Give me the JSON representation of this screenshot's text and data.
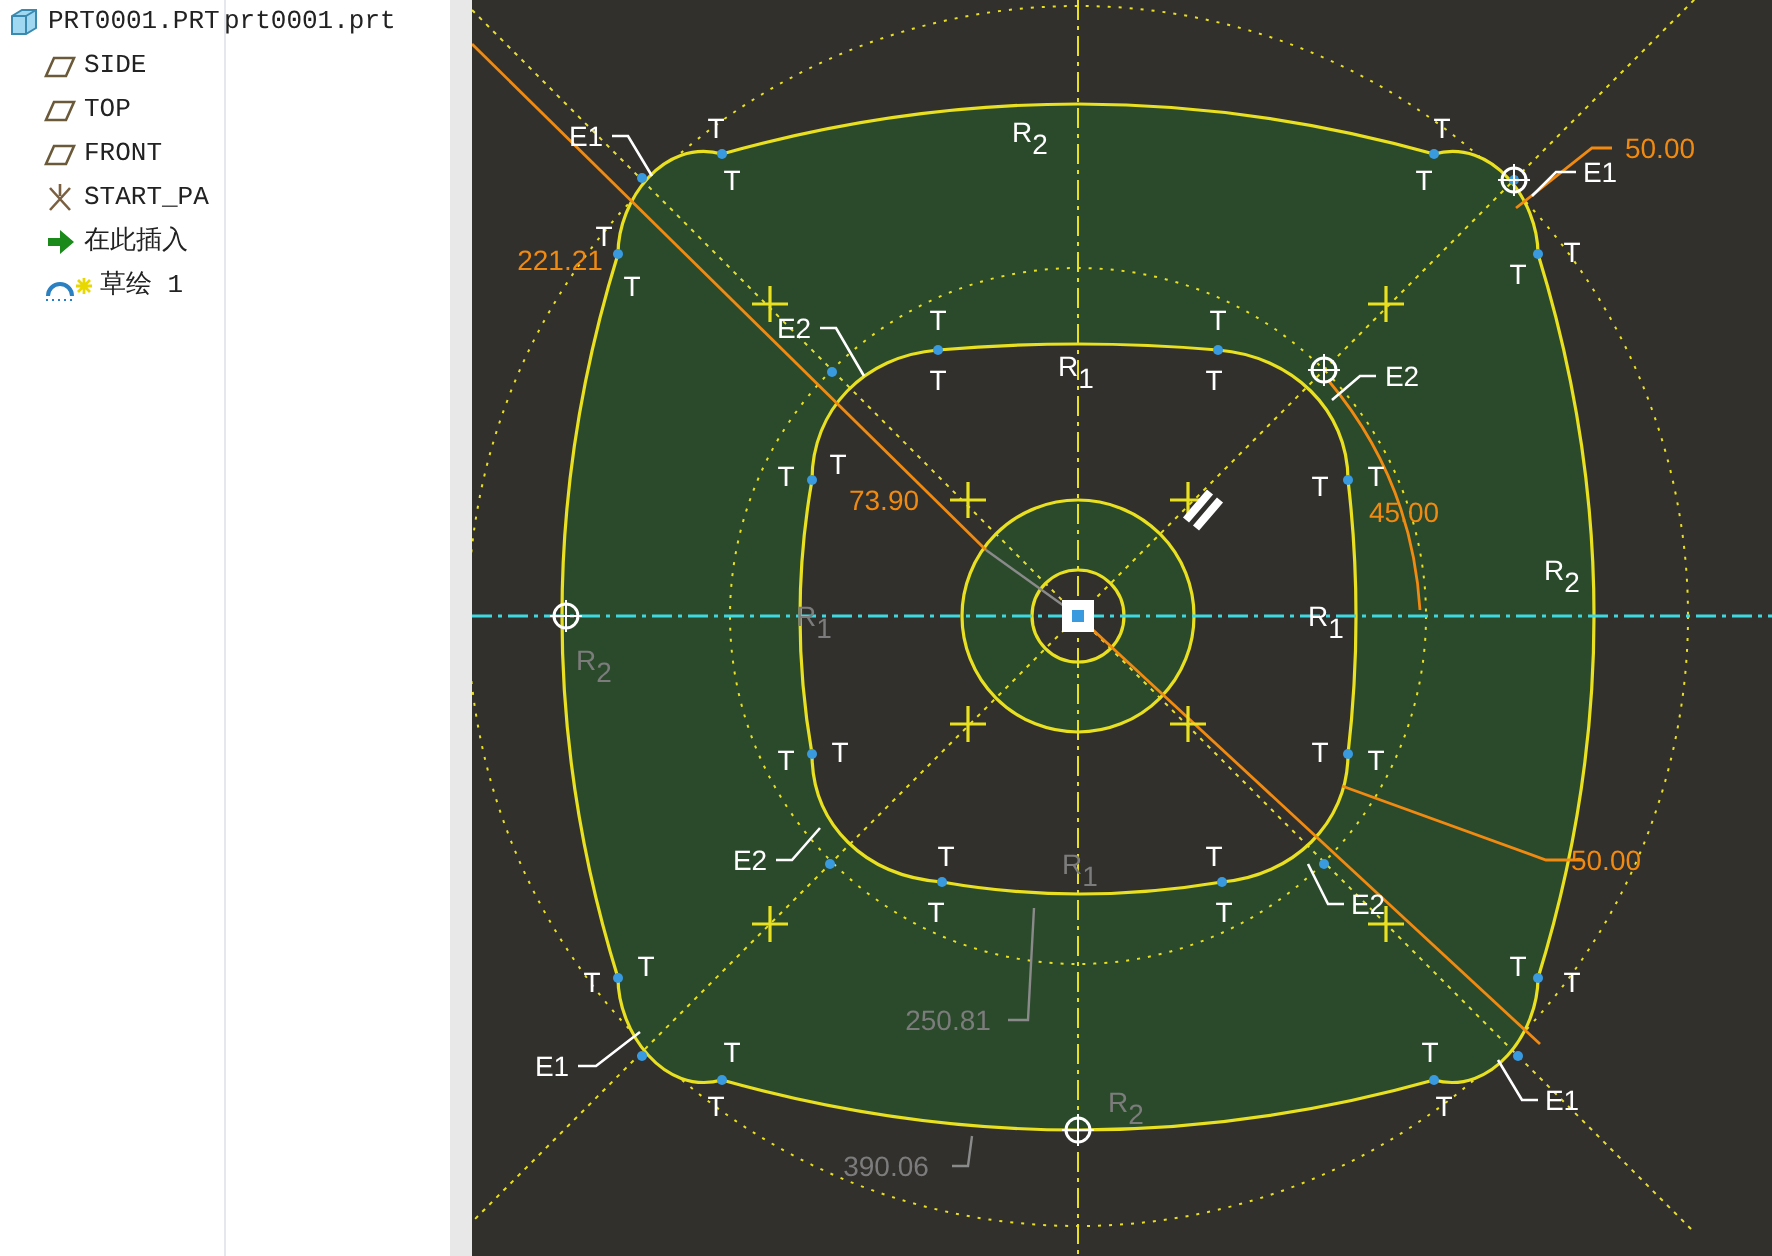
{
  "model_tree": {
    "label": "PRT0001.PRT",
    "column_2": "prt0001.prt",
    "children": [
      {
        "label": "SIDE",
        "kind": "datum_plane",
        "new": false
      },
      {
        "label": "TOP",
        "kind": "datum_plane",
        "new": false
      },
      {
        "label": "FRONT",
        "kind": "datum_plane",
        "new": false
      },
      {
        "label": "START_PA",
        "kind": "csys",
        "new": false
      },
      {
        "label": "在此插入",
        "kind": "insert_here",
        "new": false
      },
      {
        "label": "草绘 1",
        "kind": "sketch",
        "new": true
      }
    ]
  },
  "sketch": {
    "labels": [
      {
        "text": "T",
        "kind": "constraint"
      },
      {
        "text": "T",
        "kind": "constraint"
      },
      {
        "text": "T",
        "kind": "constraint"
      },
      {
        "text": "T",
        "kind": "constraint"
      },
      {
        "text": "T",
        "kind": "constraint"
      },
      {
        "text": "T",
        "kind": "constraint"
      },
      {
        "text": "T",
        "kind": "constraint"
      },
      {
        "text": "T",
        "kind": "constraint"
      },
      {
        "text": "T",
        "kind": "constraint"
      },
      {
        "text": "T",
        "kind": "constraint"
      },
      {
        "text": "T",
        "kind": "constraint"
      },
      {
        "text": "T",
        "kind": "constraint"
      },
      {
        "text": "T",
        "kind": "constraint"
      },
      {
        "text": "T",
        "kind": "constraint"
      },
      {
        "text": "T",
        "kind": "constraint"
      },
      {
        "text": "T",
        "kind": "constraint"
      },
      {
        "text": "T",
        "kind": "constraint"
      },
      {
        "text": "T",
        "kind": "constraint"
      },
      {
        "text": "T",
        "kind": "constraint"
      },
      {
        "text": "T",
        "kind": "constraint"
      },
      {
        "text": "T",
        "kind": "constraint"
      },
      {
        "text": "T",
        "kind": "constraint"
      },
      {
        "text": "T",
        "kind": "constraint"
      },
      {
        "text": "T",
        "kind": "constraint"
      },
      {
        "text": "T",
        "kind": "constraint"
      },
      {
        "text": "T",
        "kind": "constraint"
      },
      {
        "text": "T",
        "kind": "constraint"
      },
      {
        "text": "T",
        "kind": "constraint"
      },
      {
        "text": "T",
        "kind": "constraint"
      },
      {
        "text": "T",
        "kind": "constraint"
      },
      {
        "text": "T",
        "kind": "constraint"
      },
      {
        "text": "T",
        "kind": "constraint"
      },
      {
        "text": "E1",
        "kind": "constraint"
      },
      {
        "text": "E1",
        "kind": "constraint"
      },
      {
        "text": "E2",
        "kind": "constraint"
      },
      {
        "text": "E2",
        "kind": "constraint"
      },
      {
        "text": "E2",
        "kind": "constraint"
      },
      {
        "text": "E2",
        "kind": "constraint"
      },
      {
        "text": "E1",
        "kind": "constraint"
      },
      {
        "text": "E1",
        "kind": "constraint"
      },
      {
        "text": "R$_{2}$",
        "kind": "constraint"
      },
      {
        "text": "R$_{1}$",
        "kind": "constraint"
      },
      {
        "text": "R$_{1}$",
        "kind": "weak_constraint"
      },
      {
        "text": "R$_{1}$",
        "kind": "constraint"
      },
      {
        "text": "R$_{2}$",
        "kind": "constraint"
      },
      {
        "text": "R$_{2}$",
        "kind": "weak_constraint"
      },
      {
        "text": "R$_{1}$",
        "kind": "weak_constraint"
      },
      {
        "text": "R$_{2}$",
        "kind": "weak_constraint"
      },
      {
        "text": "221.21",
        "kind": "dimension"
      },
      {
        "text": "73.90",
        "kind": "dimension"
      },
      {
        "text": "45.00",
        "kind": "dimension"
      },
      {
        "text": "50.00",
        "kind": "dimension"
      },
      {
        "text": "50.00",
        "kind": "dimension"
      },
      {
        "text": "250.81",
        "kind": "weak_dimension"
      },
      {
        "text": "390.06",
        "kind": "weak_dimension"
      }
    ]
  }
}
